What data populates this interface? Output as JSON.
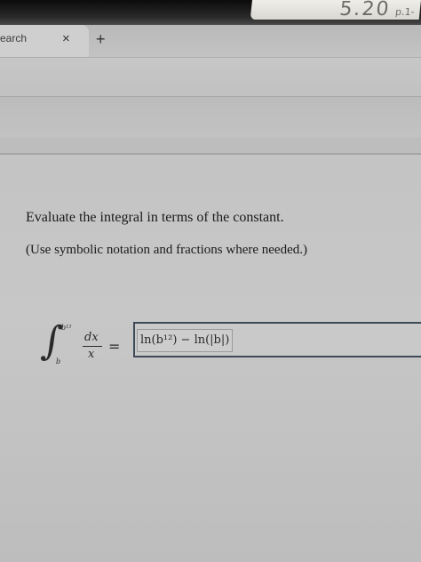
{
  "bezel": {
    "sticker_text": "5.20",
    "sticker_small": "p.1-"
  },
  "browser": {
    "tab_title": "earch",
    "tab_close": "×",
    "new_tab": "+"
  },
  "question": {
    "prompt": "Evaluate the integral in terms of the constant.",
    "instruction": "(Use symbolic notation and fractions where needed.)"
  },
  "integral": {
    "sign": "∫",
    "upper_limit": "b¹²",
    "lower_limit": "b",
    "numerator": "dx",
    "denominator": "x",
    "equals": "="
  },
  "answer": {
    "value": "ln(b¹²) − ln(|b|)"
  }
}
